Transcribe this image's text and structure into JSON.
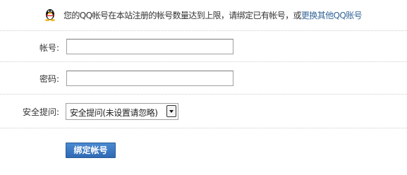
{
  "notice": {
    "icon": "qq-penguin-icon",
    "text": "您的QQ帐号在本站注册的帐号数量达到上限，请绑定已有帐号，或",
    "link_text": "更换其他QQ账号"
  },
  "form": {
    "username_label": "帐号:",
    "username_value": "",
    "password_label": "密码:",
    "password_value": "",
    "security_label": "安全提问:",
    "security_selected": "安全提问(未设置请忽略)",
    "submit_label": "绑定帐号"
  },
  "colors": {
    "link": "#336699",
    "button": "#3a78c6",
    "divider": "#cfcfcf"
  }
}
